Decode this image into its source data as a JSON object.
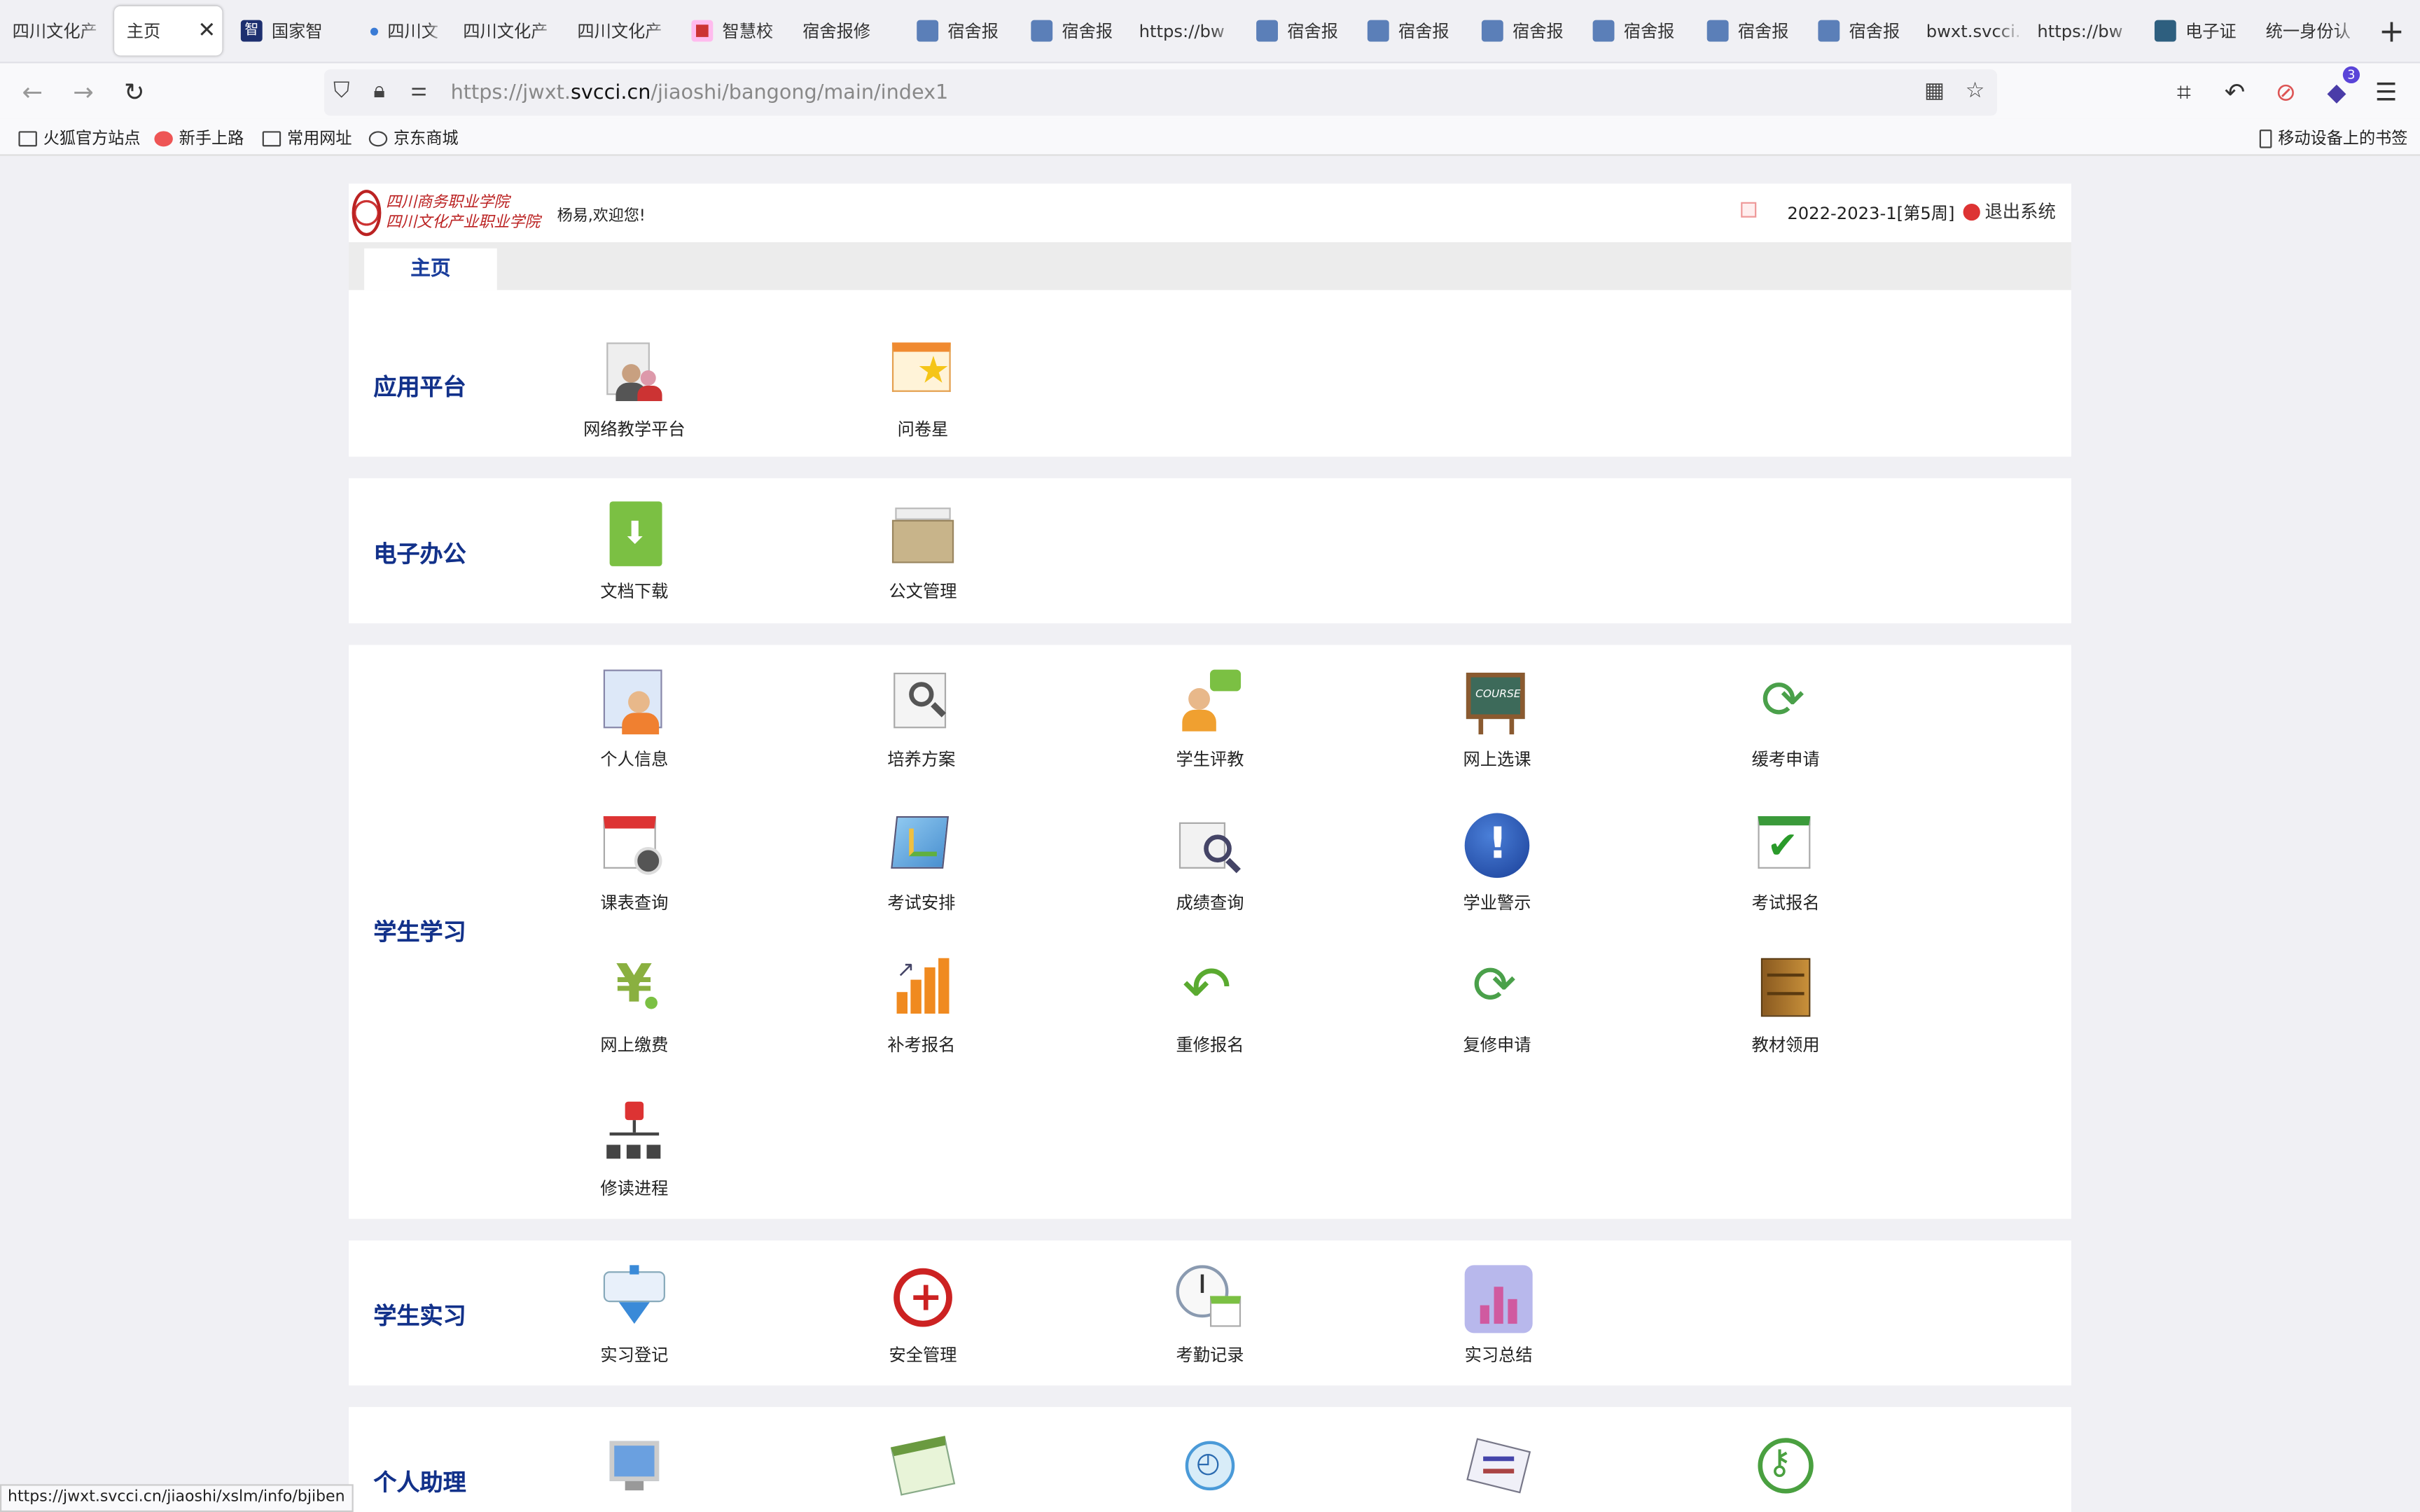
{
  "browser": {
    "tabs": [
      {
        "label": "四川文化产"
      },
      {
        "label": "主页"
      },
      {
        "label": "国家智"
      },
      {
        "label": "四川文"
      },
      {
        "label": "四川文化产"
      },
      {
        "label": "四川文化产"
      },
      {
        "label": "智慧校"
      },
      {
        "label": "宿舍报修"
      },
      {
        "label": "宿舍报"
      },
      {
        "label": "宿舍报"
      },
      {
        "label": "https://bw"
      },
      {
        "label": "宿舍报"
      },
      {
        "label": "宿舍报"
      },
      {
        "label": "宿舍报"
      },
      {
        "label": "宿舍报"
      },
      {
        "label": "宿舍报"
      },
      {
        "label": "宿舍报"
      },
      {
        "label": "bwxt.svcci."
      },
      {
        "label": "https://bw"
      },
      {
        "label": "电子证"
      },
      {
        "label": "统一身份认"
      }
    ],
    "url_prefix": "https://jwxt.",
    "url_domain": "svcci.cn",
    "url_path": "/jiaoshi/bangong/main/index1",
    "extension_badge": "3",
    "bookmarks": [
      "火狐官方站点",
      "新手上路",
      "常用网址",
      "京东商城"
    ],
    "mobile_bookmarks": "移动设备上的书签",
    "status_url": "https://jwxt.svcci.cn/jiaoshi/xslm/info/bjiben"
  },
  "page": {
    "welcome": "杨易,欢迎您!",
    "term": "2022-2023-1[第5周]",
    "logout": "退出系统",
    "home_tab": "主页",
    "logo_line1": "四川商务职业学院",
    "logo_line2": "四川文化产业职业学院",
    "sections": [
      {
        "title": "应用平台",
        "items": [
          "网络教学平台",
          "问卷星"
        ]
      },
      {
        "title": "电子办公",
        "items": [
          "文档下载",
          "公文管理"
        ]
      },
      {
        "title": "学生学习",
        "items": [
          "个人信息",
          "培养方案",
          "学生评教",
          "网上选课",
          "缓考申请",
          "课表查询",
          "考试安排",
          "成绩查询",
          "学业警示",
          "考试报名",
          "网上缴费",
          "补考报名",
          "重修报名",
          "复修申请",
          "教材领用",
          "修读进程"
        ]
      },
      {
        "title": "学生实习",
        "items": [
          "实习登记",
          "安全管理",
          "考勤记录",
          "实习总结"
        ]
      },
      {
        "title": "个人助理",
        "items": [
          "",
          "",
          "",
          "",
          ""
        ]
      }
    ]
  },
  "colors": {
    "accent": "#12318a",
    "tab_bg": "#f0f0f4",
    "logout_red": "#dd3333"
  }
}
